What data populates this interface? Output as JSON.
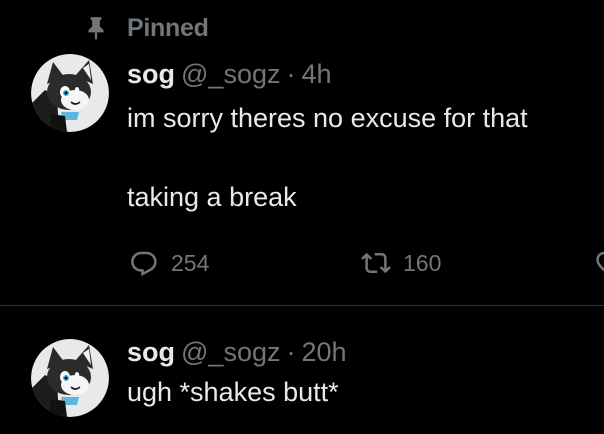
{
  "feed": {
    "tweets": [
      {
        "pinned_label": "Pinned",
        "display_name": "sog",
        "handle": "@_sogz",
        "separator": "·",
        "time": "4h",
        "text_lines": [
          "im sorry theres no excuse for that",
          "taking a break"
        ],
        "replies": "254",
        "retweets": "160"
      },
      {
        "display_name": "sog",
        "handle": "@_sogz",
        "separator": "·",
        "time": "20h",
        "text_lines": [
          "ugh *shakes butt*"
        ]
      }
    ]
  },
  "icons": {
    "pin": "pin-icon",
    "reply": "reply-icon",
    "retweet": "retweet-icon",
    "like": "like-icon"
  },
  "colors": {
    "background": "#000000",
    "text_primary": "#e7e9ea",
    "text_secondary": "#71767b",
    "divider": "#2f3336"
  }
}
